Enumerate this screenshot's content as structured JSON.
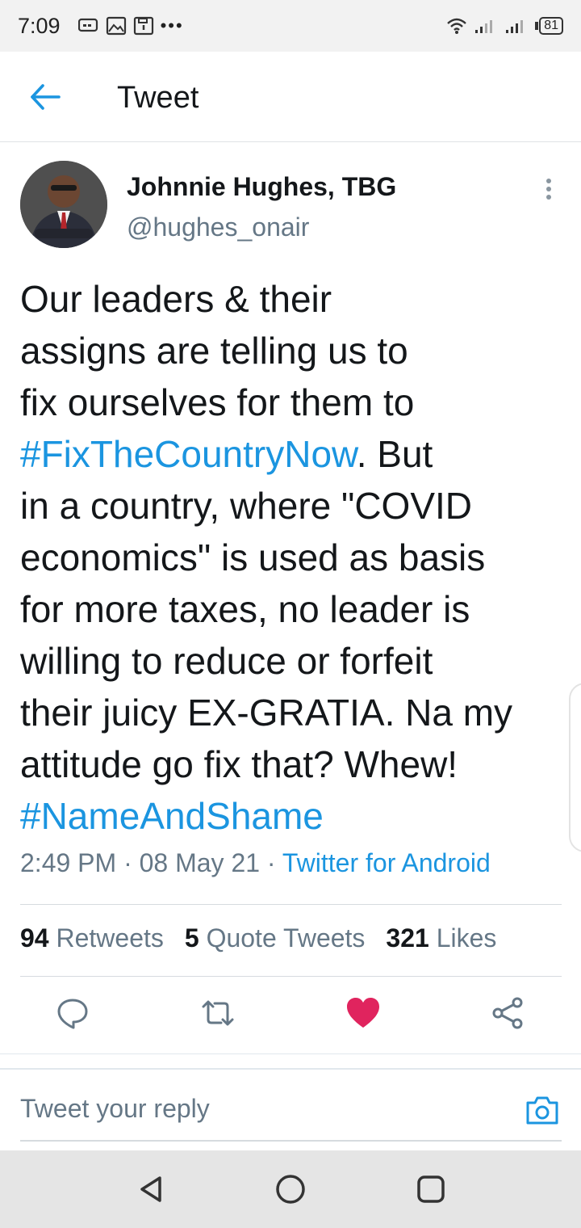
{
  "status_bar": {
    "time": "7:09",
    "battery": "81",
    "more": "•••"
  },
  "header": {
    "title": "Tweet"
  },
  "tweet": {
    "author_name": "Johnnie Hughes, TBG",
    "author_handle": "@hughes_onair",
    "body_lines": [
      {
        "text": "Our leaders & their"
      },
      {
        "text": "assigns are telling us to"
      },
      {
        "text": "fix ourselves for them to"
      },
      {
        "hashtag": "#FixTheCountryNow",
        "text": ". But"
      },
      {
        "text": "in a country, where \"COVID"
      },
      {
        "text": "economics\" is used as basis"
      },
      {
        "text": "for more taxes, no leader is"
      },
      {
        "text": "willing to reduce or forfeit"
      },
      {
        "text": "their juicy EX-GRATIA. Na my"
      },
      {
        "text": "attitude go fix that? Whew!"
      },
      {
        "hashtag": "#NameAndShame"
      }
    ],
    "time": "2:49 PM",
    "date": "08 May 21",
    "source": "Twitter for Android",
    "separator": " · "
  },
  "stats": {
    "retweets_count": "94",
    "retweets_label": "Retweets",
    "quotes_count": "5",
    "quotes_label": "Quote Tweets",
    "likes_count": "321",
    "likes_label": "Likes"
  },
  "reply": {
    "placeholder": "Tweet your reply"
  },
  "colors": {
    "accent": "#1b95e0",
    "like": "#e0245e",
    "secondary_text": "#657786"
  }
}
